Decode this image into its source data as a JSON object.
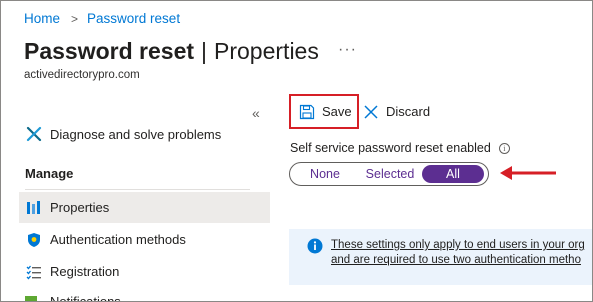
{
  "breadcrumb": {
    "home": "Home",
    "separator": ">",
    "current": "Password reset"
  },
  "header": {
    "title": "Password reset",
    "separator": "|",
    "subtitle": "Properties",
    "more_label": "···",
    "tenant": "activedirectorypro.com"
  },
  "sidebar": {
    "collapse_glyph": "«",
    "diagnose": {
      "label": "Diagnose and solve problems",
      "icon": "wrench-cross-icon"
    },
    "manage_heading": "Manage",
    "items": [
      {
        "label": "Properties",
        "icon": "properties-bars-icon",
        "selected": true
      },
      {
        "label": "Authentication methods",
        "icon": "shield-icon",
        "selected": false
      },
      {
        "label": "Registration",
        "icon": "checklist-icon",
        "selected": false
      },
      {
        "label": "Notifications",
        "icon": "notifications-icon",
        "selected": false
      }
    ]
  },
  "toolbar": {
    "save_label": "Save",
    "discard_label": "Discard"
  },
  "sspr": {
    "label": "Self service password reset enabled",
    "info_glyph": "i",
    "options": [
      "None",
      "Selected",
      "All"
    ],
    "selected": "All"
  },
  "info_bar": {
    "line1": "These settings only apply to end users in your org",
    "line2": "and are required to use two authentication metho"
  },
  "colors": {
    "link": "#0078d4",
    "accent_purple": "#5c2e91",
    "highlight_red": "#d61f26",
    "info_bg": "#ebf3fc",
    "selected_nav_bg": "#edebe9"
  }
}
